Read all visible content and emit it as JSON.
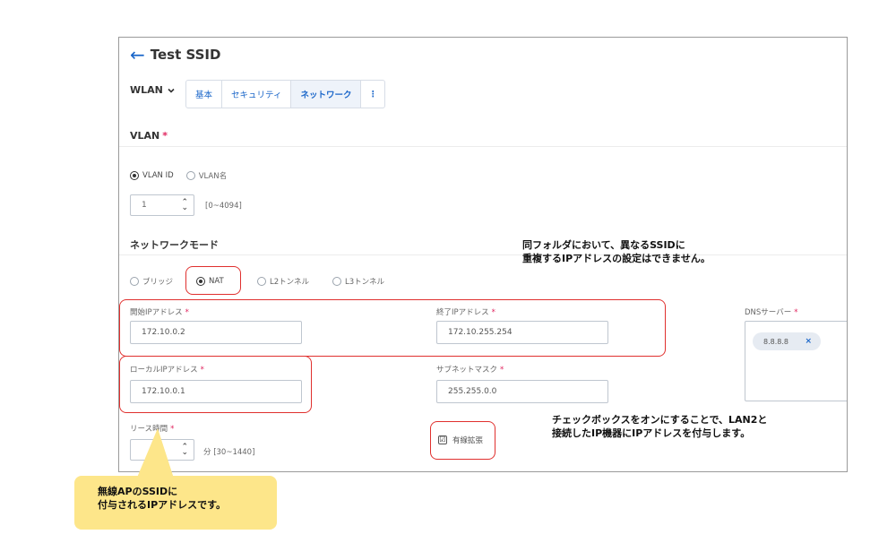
{
  "header": {
    "back_icon": "arrow-left-icon",
    "title": "Test SSID"
  },
  "wlan_selector": {
    "label": "WLAN",
    "icon": "chevron-down-icon"
  },
  "tabs": [
    {
      "label": "基本",
      "active": false
    },
    {
      "label": "セキュリティ",
      "active": false
    },
    {
      "label": "ネットワーク",
      "active": true
    },
    {
      "label": "⋮",
      "active": false
    }
  ],
  "vlan": {
    "label": "VLAN",
    "required": "*",
    "radios": [
      {
        "label": "VLAN ID",
        "selected": true
      },
      {
        "label": "VLAN名",
        "selected": false
      }
    ],
    "value": "1",
    "range": "[0~4094]"
  },
  "network_mode": {
    "label": "ネットワークモード",
    "radios": [
      {
        "label": "ブリッジ",
        "selected": false
      },
      {
        "label": "NAT",
        "selected": true
      },
      {
        "label": "L2トンネル",
        "selected": false
      },
      {
        "label": "L3トンネル",
        "selected": false
      }
    ]
  },
  "fields": {
    "start_ip": {
      "label": "開始IPアドレス",
      "value": "172.10.0.2"
    },
    "end_ip": {
      "label": "終了IPアドレス",
      "value": "172.10.255.254"
    },
    "local_ip": {
      "label": "ローカルIPアドレス",
      "value": "172.10.0.1"
    },
    "subnet_mask": {
      "label": "サブネットマスク",
      "value": "255.255.0.0"
    },
    "dns": {
      "label": "DNSサーバー",
      "chip": "8.8.8.8",
      "chip_remove": "×"
    },
    "lease": {
      "label": "リース時間",
      "value": "",
      "range": "分 [30~1440]"
    },
    "wired_ext": {
      "label": "有線拡張",
      "checked": true,
      "check": "☑"
    }
  },
  "annotations": {
    "top_note": [
      "同フォルダにおいて、異なるSSIDに",
      "重複するIPアドレスの設定はできません。"
    ],
    "bottom_note": [
      "チェックボックスをオンにすることで、LAN2と",
      "接続したIP機器にIPアドレスを付与します。"
    ],
    "yellow_note": [
      "無線APのSSIDに",
      "付与されるIPアドレスです。"
    ]
  },
  "colors": {
    "accent": "#1a66c9",
    "required": "#e0245e",
    "callout_red": "#e0302e",
    "callout_yellow": "#fde68a"
  }
}
